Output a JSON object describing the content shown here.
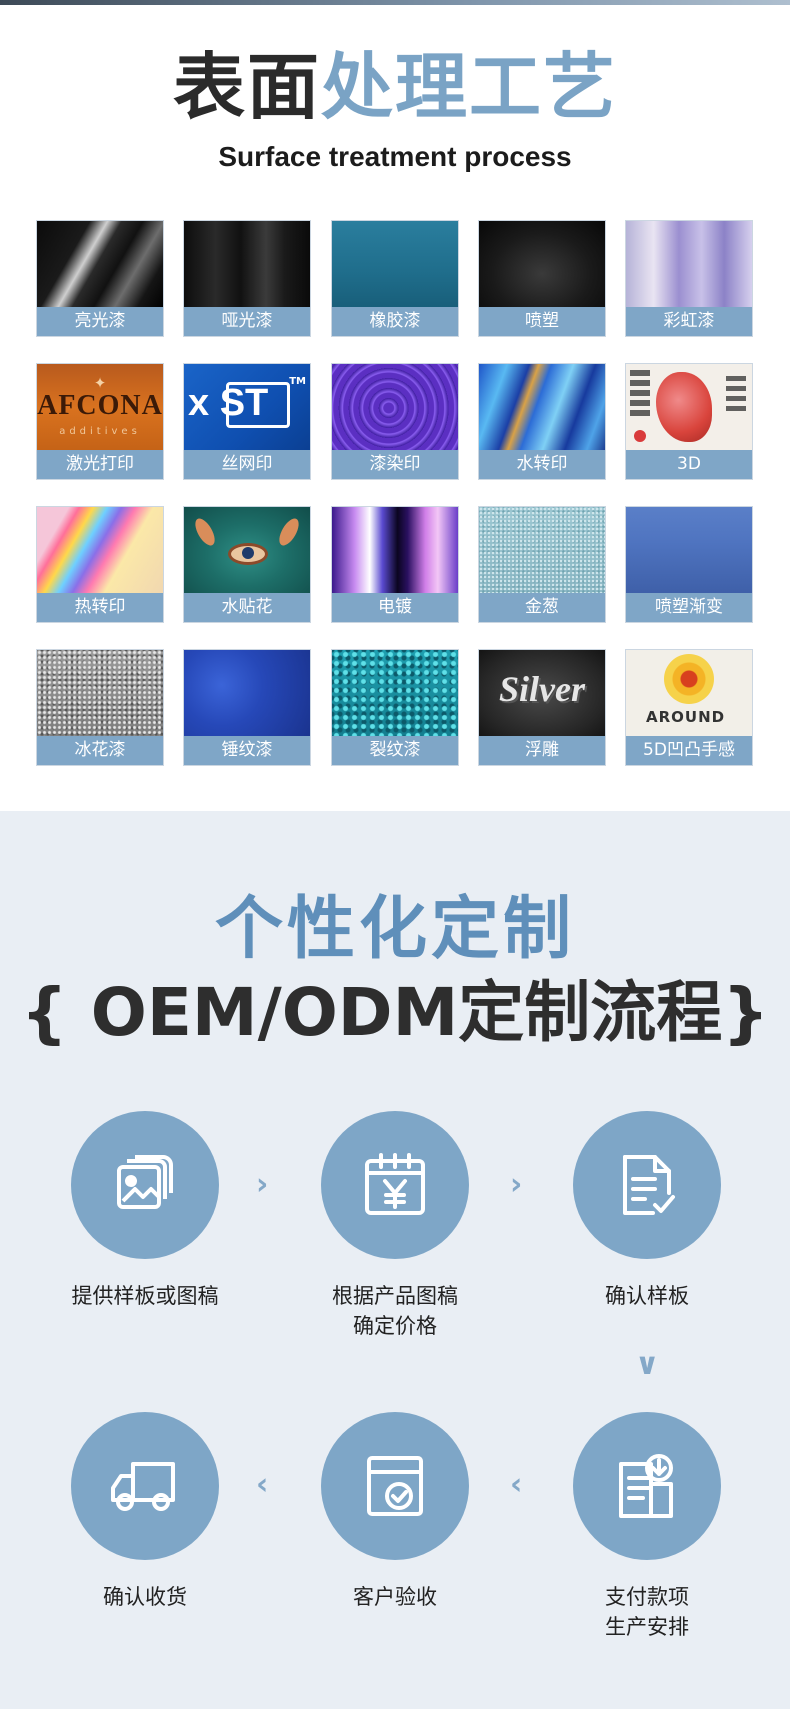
{
  "section1": {
    "title_dark": "表面",
    "title_blue": "处理工艺",
    "subtitle": "Surface treatment process",
    "tiles": [
      {
        "label": "亮光漆",
        "icon": "glossy-paint-swatch"
      },
      {
        "label": "哑光漆",
        "icon": "matte-paint-swatch"
      },
      {
        "label": "橡胶漆",
        "icon": "rubber-paint-swatch"
      },
      {
        "label": "喷塑",
        "icon": "powder-coat-swatch"
      },
      {
        "label": "彩虹漆",
        "icon": "rainbow-paint-swatch"
      },
      {
        "label": "激光打印",
        "icon": "laser-print-swatch",
        "text": "AFCONA",
        "subtext": "additives"
      },
      {
        "label": "丝网印",
        "icon": "screen-print-swatch",
        "text": "x ST",
        "subtext": "TM"
      },
      {
        "label": "漆染印",
        "icon": "dye-print-swatch"
      },
      {
        "label": "水转印",
        "icon": "water-transfer-swatch"
      },
      {
        "label": "3D",
        "icon": "3d-print-swatch"
      },
      {
        "label": "热转印",
        "icon": "heat-transfer-swatch"
      },
      {
        "label": "水贴花",
        "icon": "water-decal-swatch"
      },
      {
        "label": "电镀",
        "icon": "electroplate-swatch"
      },
      {
        "label": "金葱",
        "icon": "glitter-swatch"
      },
      {
        "label": "喷塑渐变",
        "icon": "gradient-powder-swatch"
      },
      {
        "label": "冰花漆",
        "icon": "ice-flower-swatch"
      },
      {
        "label": "锤纹漆",
        "icon": "hammer-tone-swatch"
      },
      {
        "label": "裂纹漆",
        "icon": "crackle-paint-swatch"
      },
      {
        "label": "浮雕",
        "icon": "embossed-swatch",
        "text": "Silver"
      },
      {
        "label": "5D凹凸手感",
        "icon": "5d-texture-swatch",
        "text": "AROUND"
      }
    ]
  },
  "section2": {
    "title": "个性化定制",
    "subtitle": "{ OEM/ODM定制流程}",
    "steps": [
      {
        "label": "提供样板或图稿",
        "icon": "image-cards-icon"
      },
      {
        "label": "根据产品图稿\n确定价格",
        "icon": "calendar-yen-icon"
      },
      {
        "label": "确认样板",
        "icon": "document-check-icon"
      },
      {
        "label": "支付款项\n生产安排",
        "icon": "document-download-icon"
      },
      {
        "label": "客户验收",
        "icon": "inbox-check-icon"
      },
      {
        "label": "确认收货",
        "icon": "truck-icon"
      }
    ],
    "arrows": {
      "right": "›",
      "left": "‹",
      "down": "∨"
    },
    "colors": {
      "accent": "#7ea6c7",
      "title_blue": "#5f8fba",
      "bg": "#e9eef4"
    }
  }
}
